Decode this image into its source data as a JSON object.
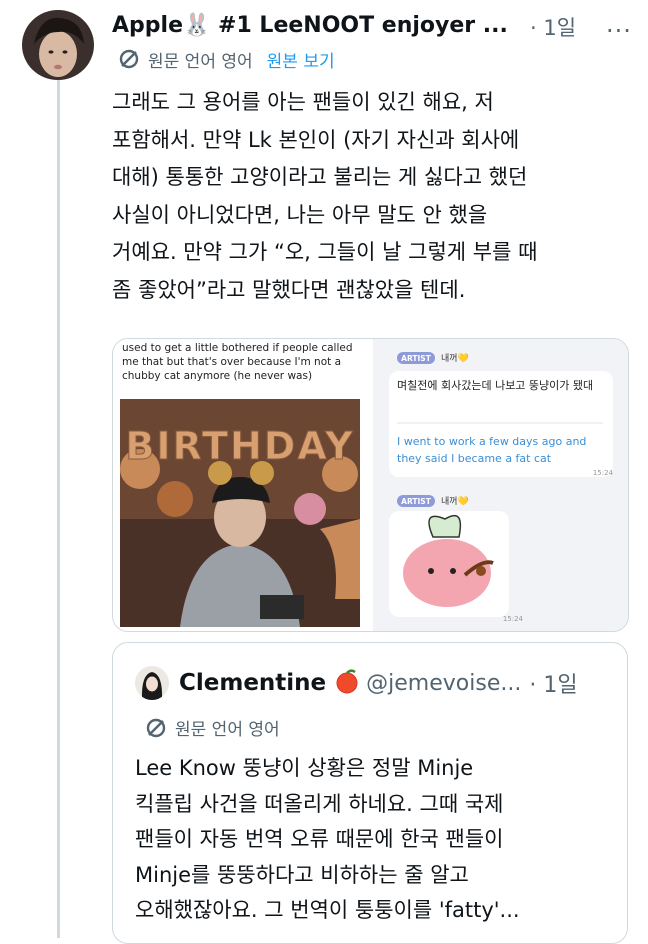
{
  "tweet": {
    "author_name": "Apple🐰 #1 LeeNOOT enjoyer ...",
    "time": "· 1일",
    "more": "...",
    "translation_label": "원문 언어 영어",
    "show_original": "원본 보기",
    "text_lines": [
      "그래도 그 용어를 아는 팬들이 있긴 해요, 저",
      "포함해서. 만약 Lk 본인이 (자기 자신과 회사에",
      "대해) 통통한 고양이라고 불리는 게 싫다고 했던",
      "사실이 아니었다면, 나는 아무 말도 안 했을",
      "거예요. 만약 그가 “오, 그들이 날 그렇게 부를 때",
      "좀 좋았어”라고 말했다면 괜찮았을 텐데."
    ]
  },
  "media": {
    "caption_lines": [
      "used to get a little bothered if people called",
      "me that but that's over because I'm not a",
      "chubby cat anymore (he never was)"
    ],
    "balloon_text": "BIRTHDAY",
    "artist_badge": "ARTIST",
    "artist_name": "내꺼💛",
    "bubble_korean": "며칠전에 회사갔는데 나보고 뚱냥이가 됐대",
    "bubble_english": "I went to work a few days ago and they said I became a fat cat",
    "time_1": "15:24",
    "time_2": "15:24"
  },
  "quote": {
    "name": "Clementine",
    "handle": "@jemevoise...",
    "time": "· 1일",
    "translation_label": "원문 언어 영어",
    "text_lines": [
      "Lee Know 뚱냥이 상황은 정말 Minje",
      "킥플립 사건을 떠올리게 하네요. 그때 국제",
      "팬들이 자동 번역 오류 때문에 한국 팬들이",
      "Minje를 뚱뚱하다고 비하하는 줄 알고",
      "오해했잖아요. 그 번역이 퉁퉁이를 'fatty'..."
    ]
  },
  "colors": {
    "text": "#0f1419",
    "secondary": "#536471",
    "link": "#1d9bf0",
    "border": "#cfd9de",
    "artist_badge": "#8e9bd8"
  }
}
